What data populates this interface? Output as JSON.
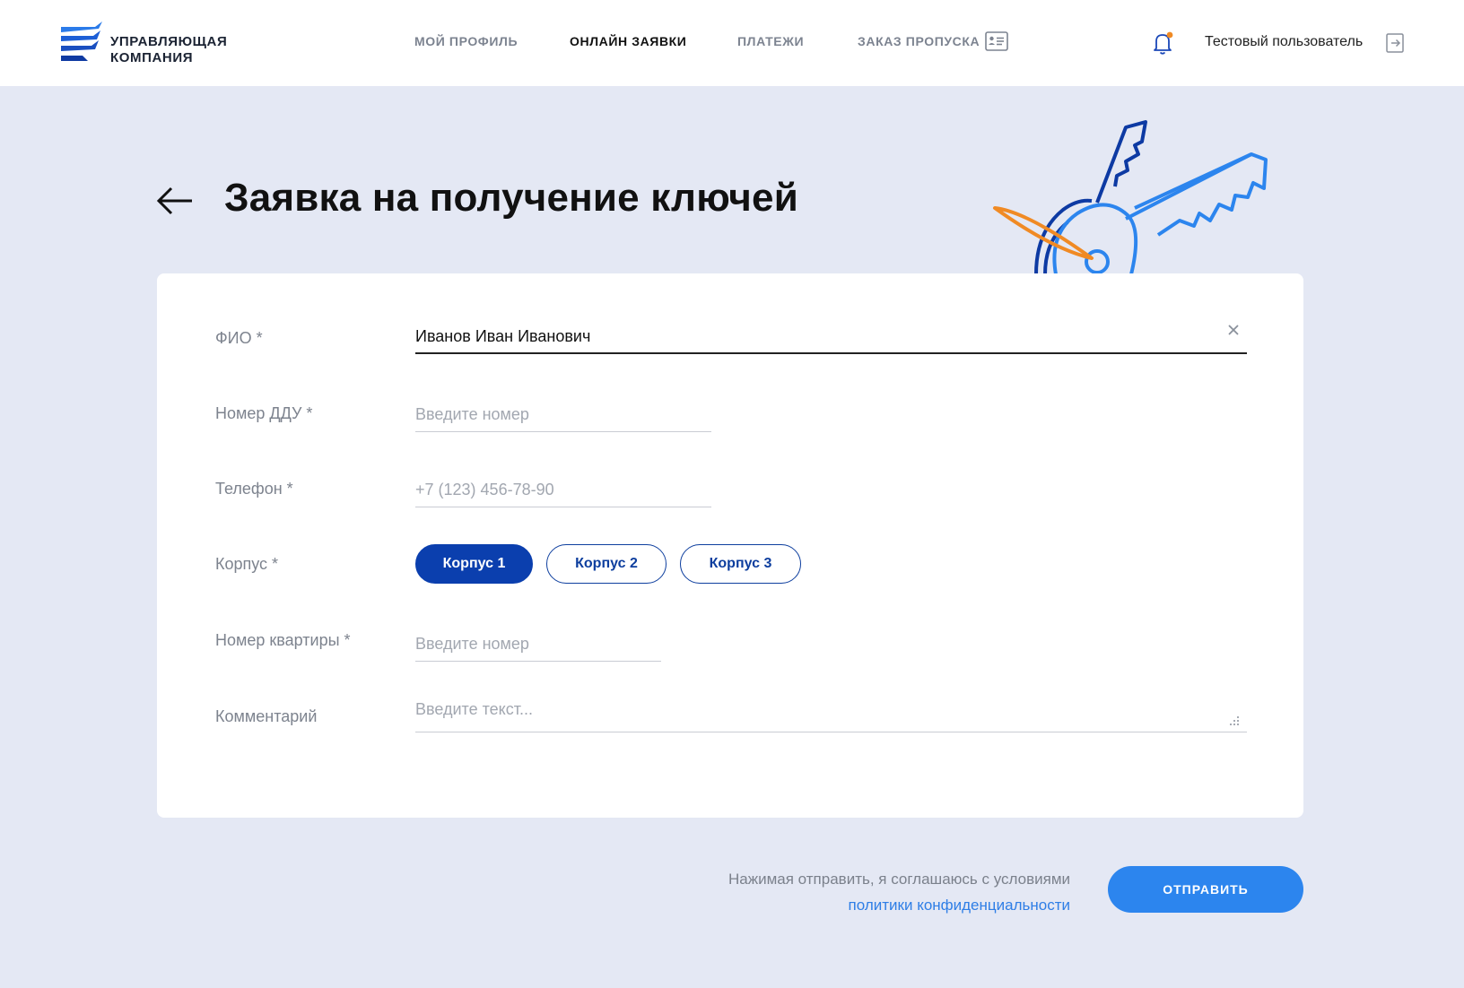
{
  "header": {
    "logo_line1": "УПРАВЛЯЮЩАЯ",
    "logo_line2": "КОМПАНИЯ",
    "nav": {
      "profile": "МОЙ ПРОФИЛЬ",
      "online": "ОНЛАЙН ЗАЯВКИ",
      "payments": "ПЛАТЕЖИ",
      "pass": "ЗАКАЗ ПРОПУСКА"
    },
    "active_nav": "ОНЛАЙН ЗАЯВКИ",
    "user_name": "Тестовый пользователь",
    "icons": {
      "pass": "id-card-icon",
      "bell": "bell-icon",
      "logout": "logout-icon"
    }
  },
  "page": {
    "title": "Заявка на получение ключей",
    "illustration": "keys-illustration"
  },
  "form": {
    "fio": {
      "label": "ФИО *",
      "value": "Иванов Иван Иванович"
    },
    "ddu": {
      "label": "Номер ДДУ *",
      "placeholder": "Введите номер"
    },
    "phone": {
      "label": "Телефон *",
      "placeholder": "+7 (123) 456-78-90"
    },
    "building": {
      "label": "Корпус *",
      "options": [
        "Корпус 1",
        "Корпус 2",
        "Корпус 3"
      ],
      "selected": "Корпус 1"
    },
    "apartment": {
      "label": "Номер квартиры *",
      "placeholder": "Введите номер"
    },
    "comment": {
      "label": "Комментарий",
      "placeholder": "Введите текст..."
    }
  },
  "footer": {
    "agree_text": "Нажимая отправить, я соглашаюсь с условиями",
    "agree_link": "политики конфиденциальности",
    "submit_label": "ОТПРАВИТЬ"
  },
  "colors": {
    "background": "#e4e8f4",
    "primary_dark": "#0b3fae",
    "primary": "#2c85ee",
    "accent": "#f08a24"
  }
}
